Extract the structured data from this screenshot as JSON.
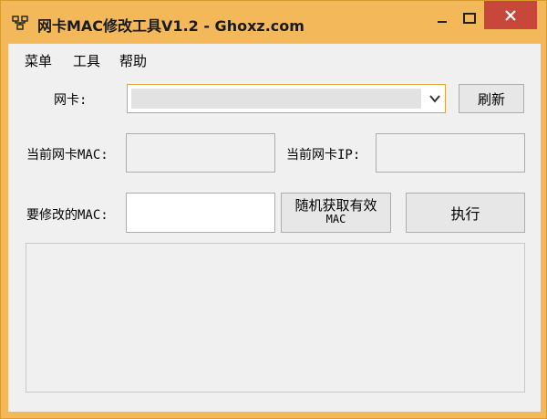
{
  "window": {
    "title": "网卡MAC修改工具V1.2 - Ghoxz.com"
  },
  "menu": {
    "items": [
      {
        "label": "菜单"
      },
      {
        "label": "工具"
      },
      {
        "label": "帮助"
      }
    ]
  },
  "form": {
    "adapter_label": "网卡:",
    "adapter_value": "",
    "refresh_label": "刷新",
    "current_mac_label": "当前网卡MAC:",
    "current_mac_value": "",
    "current_ip_label": "当前网卡IP:",
    "current_ip_value": "",
    "target_mac_label": "要修改的MAC:",
    "target_mac_value": "",
    "random_label_line1": "随机获取有效",
    "random_label_line2": "MAC",
    "execute_label": "执行"
  },
  "log": {
    "content": ""
  },
  "colors": {
    "frame": "#f2b85a",
    "close_button": "#c7483b",
    "combo_focus": "#e0a13a"
  }
}
